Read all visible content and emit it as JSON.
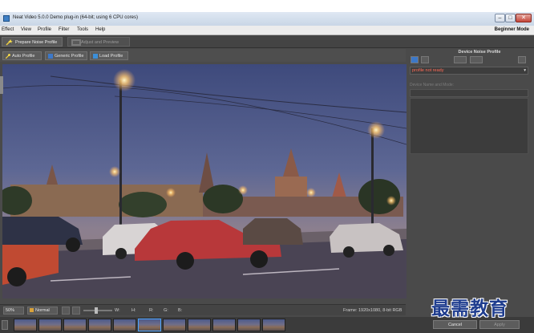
{
  "window": {
    "title": "Neat Video 5.0.0 Demo plug-in (64-bit; using 6 CPU cores)",
    "minimize_glyph": "–",
    "maximize_glyph": "□",
    "close_glyph": "✕"
  },
  "menu": {
    "items": [
      "Effect",
      "View",
      "Profile",
      "Filter",
      "Tools",
      "Help"
    ],
    "mode": "Beginner Mode"
  },
  "steps": {
    "prepare_label": "Prepare Noise Profile",
    "adjust_label": "Adjust and Preview"
  },
  "toolbar": {
    "auto_label": "Auto Profile",
    "generic_label": "Generic Profile",
    "load_label": "Load Profile"
  },
  "statusbar": {
    "zoom": "50%",
    "view_mode": "Normal",
    "readout_w": "W:",
    "readout_h": "H:",
    "readout_r": "R:",
    "readout_g": "G:",
    "readout_b": "B:",
    "frame_info": "Frame: 1920x1080, 8-bit RGB"
  },
  "panel": {
    "title": "Device Noise Profile",
    "profile_status": "profile not ready",
    "device_label": "Device Name and Mode:"
  },
  "buttons": {
    "cancel": "Cancel",
    "apply": "Apply"
  },
  "watermark": "最需教育",
  "colors": {
    "status_warning": "#ff6a55",
    "selection": "#4aa3ff",
    "watermark": "#1f3d8f"
  }
}
